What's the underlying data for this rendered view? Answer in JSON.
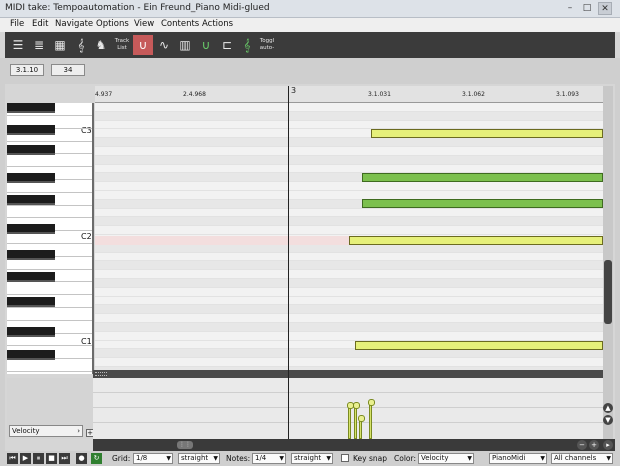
{
  "window": {
    "title": "MIDI take: Tempoautomation - Ein Freund_Piano Midi-glued",
    "minimize_glyph": "–",
    "maximize_glyph": "□",
    "close_glyph": "✕"
  },
  "menu": [
    "File",
    "Edit",
    "Navigate",
    "Options",
    "View",
    "Contents",
    "Actions"
  ],
  "toolbar": {
    "track_list_label": "Track List",
    "toggle_label": "Toggl auto-"
  },
  "info": {
    "position": "3.1.10",
    "value": "34"
  },
  "ruler": {
    "marker": "3",
    "labels": [
      "4.937",
      "2.4.968",
      "3.1.031",
      "3.1.062",
      "3.1.093"
    ]
  },
  "piano": {
    "labels": [
      "C3",
      "C2",
      "C1"
    ]
  },
  "notes": [
    {
      "color": "yellow"
    },
    {
      "color": "green"
    },
    {
      "color": "green"
    },
    {
      "color": "yellow"
    },
    {
      "color": "yellow"
    }
  ],
  "cc_lane": {
    "selector": "Velocity",
    "add": "+"
  },
  "status": {
    "grid_label": "Grid:",
    "grid_value": "1/8",
    "grid_mode": "straight",
    "notes_label": "Notes:",
    "notes_value": "1/4",
    "notes_mode": "straight",
    "keysnap_label": "Key snap",
    "color_label": "Color:",
    "color_value": "Velocity",
    "keymap_value": "PianoMidi",
    "channels_value": "All channels"
  },
  "colors": {
    "note_yellow": "#e6f07a",
    "note_green": "#7cc04e",
    "toolbar_bg": "#3b3b3b",
    "active_tool": "#c65a5a"
  }
}
